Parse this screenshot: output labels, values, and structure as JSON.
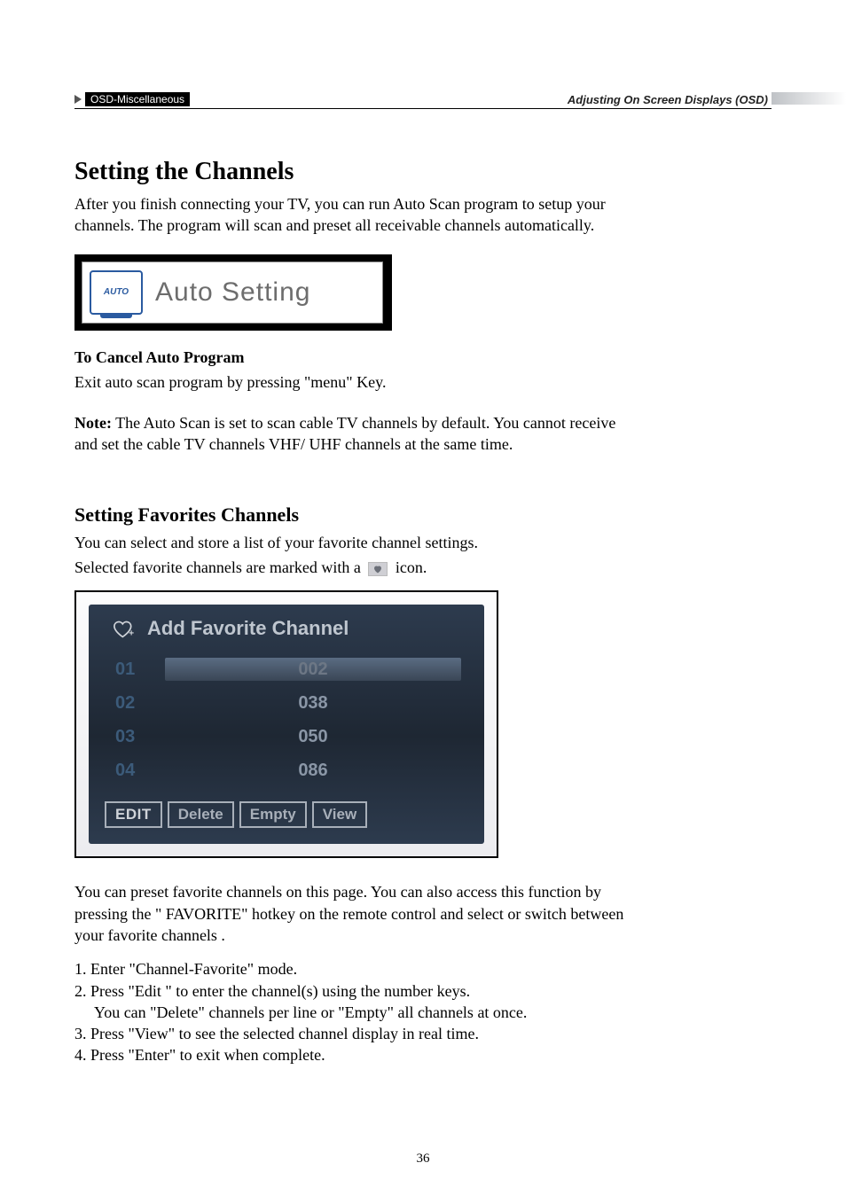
{
  "header": {
    "breadcrumb": "OSD-Miscellaneous",
    "right_label": "Adjusting On Screen Displays (OSD)"
  },
  "section1": {
    "title": "Setting the Channels",
    "intro": "After you finish connecting your TV, you can run Auto Scan program to setup your channels. The program will scan and preset all receivable channels automatically.",
    "auto_small_label": "AUTO",
    "auto_setting_label": "Auto Setting",
    "cancel_heading": "To Cancel Auto Program",
    "cancel_text": "Exit auto scan program by pressing \"menu\" Key.",
    "note_label": "Note:",
    "note_text": " The Auto Scan is set to scan cable TV channels by default. You cannot receive and set the cable TV channels VHF/ UHF channels at the same time."
  },
  "section2": {
    "title": "Setting Favorites Channels",
    "intro_line1": "You can select and store a list of your favorite channel settings.",
    "intro_line2_a": "Selected favorite channels are marked with a ",
    "intro_line2_b": " icon.",
    "panel_title": "Add Favorite Channel",
    "rows": [
      {
        "idx": "01",
        "val": "002",
        "selected": true
      },
      {
        "idx": "02",
        "val": "038",
        "selected": false
      },
      {
        "idx": "03",
        "val": "050",
        "selected": false
      },
      {
        "idx": "04",
        "val": "086",
        "selected": false
      }
    ],
    "buttons": {
      "edit": "EDIT",
      "delete": "Delete",
      "empty": "Empty",
      "view": "View"
    },
    "after_panel": "You can preset favorite channels on this page. You can also access this function by pressing the \" FAVORITE\" hotkey on the remote control and select or switch between your favorite channels .",
    "steps": [
      "1. Enter \"Channel-Favorite\" mode.",
      "2. Press \"Edit \" to enter the channel(s) using the number keys.",
      "    You can \"Delete\" channels per line or \"Empty\" all channels at once.",
      "3. Press \"View\" to see the selected channel display in real time.",
      "4. Press \"Enter\" to exit when complete."
    ]
  },
  "page_number": "36"
}
